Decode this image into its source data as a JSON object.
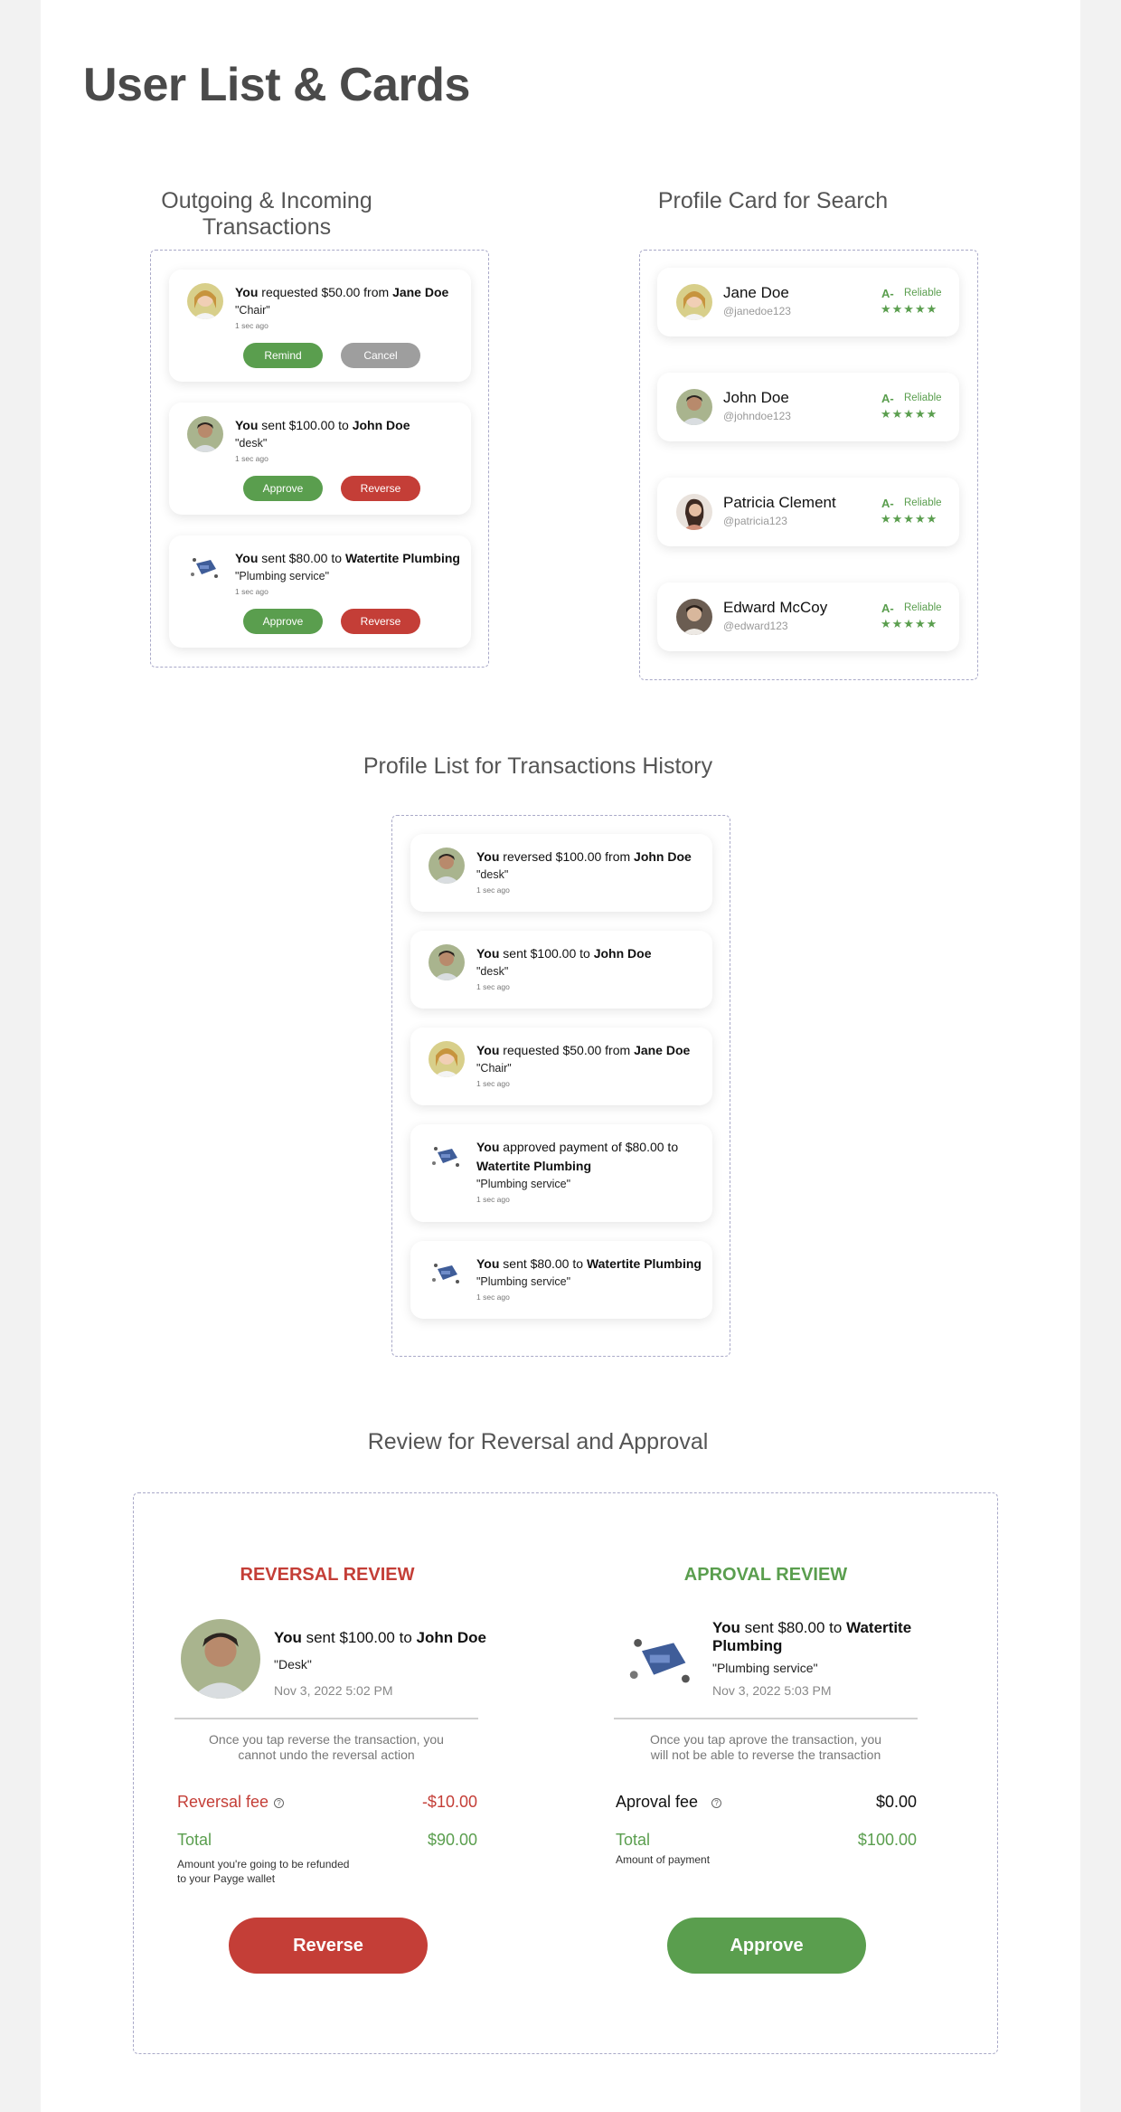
{
  "page_title": "User List & Cards",
  "sections": {
    "transactions": "Outgoing & Incoming Transactions",
    "profile_search": "Profile Card for Search",
    "history": "Profile List for Transactions History",
    "review": "Review for Reversal and Approval"
  },
  "transactions": [
    {
      "you": "You",
      "verb": " requested $50.00 from ",
      "party": "Jane Doe",
      "note": "\"Chair\"",
      "time": "1 sec ago",
      "btn1": "Remind",
      "btn2": "Cancel"
    },
    {
      "you": "You",
      "verb": " sent $100.00 to ",
      "party": "John Doe",
      "note": "\"desk\"",
      "time": "1 sec ago",
      "btn1": "Approve",
      "btn2": "Reverse"
    },
    {
      "you": "You",
      "verb": " sent $80.00 to ",
      "party": "Watertite Plumbing",
      "note": "\"Plumbing service\"",
      "time": "1 sec ago",
      "btn1": "Approve",
      "btn2": "Reverse"
    }
  ],
  "profiles": [
    {
      "name": "Jane Doe",
      "handle": "@janedoe123",
      "grade": "A-",
      "label": "Reliable",
      "stars": "★★★★★"
    },
    {
      "name": "John Doe",
      "handle": "@johndoe123",
      "grade": "A-",
      "label": "Reliable",
      "stars": "★★★★★"
    },
    {
      "name": "Patricia Clement",
      "handle": "@patricia123",
      "grade": "A-",
      "label": "Reliable",
      "stars": "★★★★★"
    },
    {
      "name": "Edward McCoy",
      "handle": "@edward123",
      "grade": "A-",
      "label": "Reliable",
      "stars": "★★★★★"
    }
  ],
  "history": [
    {
      "you": "You",
      "verb": " reversed $100.00 from ",
      "party": "John Doe",
      "note": "\"desk\"",
      "time": "1 sec ago"
    },
    {
      "you": "You",
      "verb": " sent $100.00 to ",
      "party": "John Doe",
      "note": "\"desk\"",
      "time": "1 sec ago"
    },
    {
      "you": "You",
      "verb": " requested $50.00 from ",
      "party": "Jane Doe",
      "note": "\"Chair\"",
      "time": "1 sec ago"
    },
    {
      "you": "You",
      "verb": " approved payment of $80.00 to",
      "party": "Watertite Plumbing",
      "note": "\"Plumbing service\"",
      "time": "1 sec ago"
    },
    {
      "you": "You",
      "verb": " sent $80.00 to ",
      "party": "Watertite Plumbing",
      "note": "\"Plumbing service\"",
      "time": "1 sec ago"
    }
  ],
  "reversal": {
    "heading": "REVERSAL REVIEW",
    "you": "You",
    "verb": " sent $100.00 to ",
    "party": "John Doe",
    "note": "\"Desk\"",
    "date": "Nov 3, 2022 5:02 PM",
    "warning": "Once you tap reverse the transaction, you cannot undo the reversal action",
    "fee_label": "Reversal fee",
    "fee_value": "-$10.00",
    "total_label": "Total",
    "total_value": "$90.00",
    "total_note": "Amount you're going to be refunded to your Payge wallet",
    "button": "Reverse"
  },
  "approval": {
    "heading": "APROVAL REVIEW",
    "you": "You",
    "verb": " sent $80.00 to ",
    "party": "Watertite Plumbing",
    "note": "\"Plumbing service\"",
    "date": "Nov 3, 2022 5:03 PM",
    "warning": "Once you tap aprove the transaction, you will not be able to reverse the transaction",
    "fee_label": "Aproval fee",
    "fee_value": "$0.00",
    "total_label": "Total",
    "total_value": "$100.00",
    "total_note": "Amount of payment",
    "button": "Approve"
  },
  "colors": {
    "green": "#5a9e4e",
    "red": "#c43e37",
    "grey": "#9e9e9e",
    "dashed": "#a9a9c8"
  },
  "icons": {
    "help": "help-circle-icon",
    "star": "star-icon"
  }
}
